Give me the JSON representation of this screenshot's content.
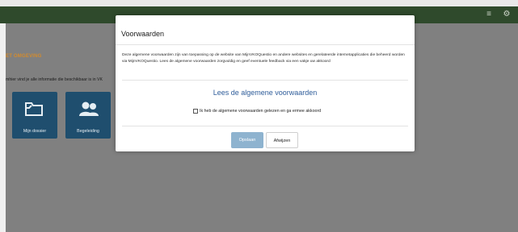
{
  "header": {
    "icons": [
      "menu-icon",
      "gear-icon"
    ]
  },
  "page": {
    "section_title": "ET OMGEVING",
    "intro": "mhier vind je alle informatie die beschikbaar is in VK",
    "tiles": [
      {
        "label": "Mijn dossier",
        "icon": "folder-icon"
      },
      {
        "label": "Begeleiding",
        "icon": "users-icon"
      }
    ]
  },
  "modal": {
    "title": "Voorwaarden",
    "text": "Deze algemene voorwaarden zijn van toepassing op de website van MijnVKOQuestio en andere websites en gerelateerde internetapplicaties die beheerd worden via MijnVKOQuestio. Lees de algemene voorwaarden zorgvuldig en geef eventuele feedback via een vakje uw akkoord",
    "link": "Lees de algemene voorwaarden",
    "agree_label": "Ik heb de algemene voorwaarden gelezen en ga ermee akkoord",
    "save_label": "Opslaan",
    "cancel_label": "Afwijzen"
  },
  "colors": {
    "header": "#2f4a2c",
    "section_title": "#d38b2d",
    "tile": "#1f4e6e",
    "link": "#2f5d9a",
    "save_button": "#8eb3cf",
    "overlay": "#808080"
  }
}
